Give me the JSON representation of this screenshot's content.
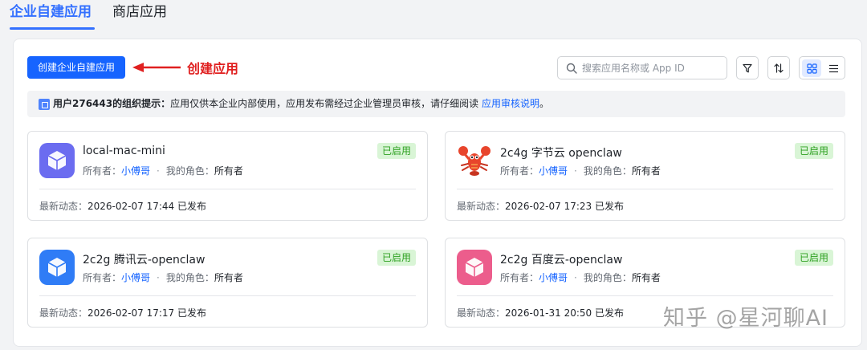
{
  "tabs": [
    {
      "label": "企业自建应用",
      "active": true
    },
    {
      "label": "商店应用",
      "active": false
    }
  ],
  "toolbar": {
    "create_button": "创建企业自建应用",
    "annotation": "创建应用",
    "search_placeholder": "搜索应用名称或 App ID",
    "filter_icon": "filter-icon",
    "sort_icon": "sort-icon",
    "grid_icon": "grid-view-icon",
    "list_icon": "list-view-icon"
  },
  "notice": {
    "prefix": "用户276443的组织提示：",
    "body": "应用仅供本企业内部使用，应用发布需经过企业管理员审核，请仔细阅读 ",
    "link": "应用审核说明",
    "suffix": "。"
  },
  "labels": {
    "owner": "所有者：",
    "role": "我的角色：",
    "dot": "·",
    "activity": "最新动态："
  },
  "apps": [
    {
      "name": "local-mac-mini",
      "status": "已启用",
      "owner": "小傅哥",
      "role": "所有者",
      "activity": "2026-02-07 17:44 已发布",
      "icon": "cube-icon",
      "icon_color": "#6b6cf0"
    },
    {
      "name": "2c4g 字节云 openclaw",
      "status": "已启用",
      "owner": "小傅哥",
      "role": "所有者",
      "activity": "2026-02-07 17:23 已发布",
      "icon": "lobster-icon",
      "icon_color": "#e8452c"
    },
    {
      "name": "2c2g 腾讯云-openclaw",
      "status": "已启用",
      "owner": "小傅哥",
      "role": "所有者",
      "activity": "2026-02-07 17:17 已发布",
      "icon": "cube-icon",
      "icon_color": "#2f7cf6"
    },
    {
      "name": "2c2g 百度云-openclaw",
      "status": "已启用",
      "owner": "小傅哥",
      "role": "所有者",
      "activity": "2026-01-31 20:50 已发布",
      "icon": "cube-icon",
      "icon_color": "#ec5d8c"
    }
  ],
  "watermark": "知乎 @星河聊AI",
  "colors": {
    "accent": "#1664ff",
    "success": "#2ea121",
    "annotation": "#e02020"
  }
}
